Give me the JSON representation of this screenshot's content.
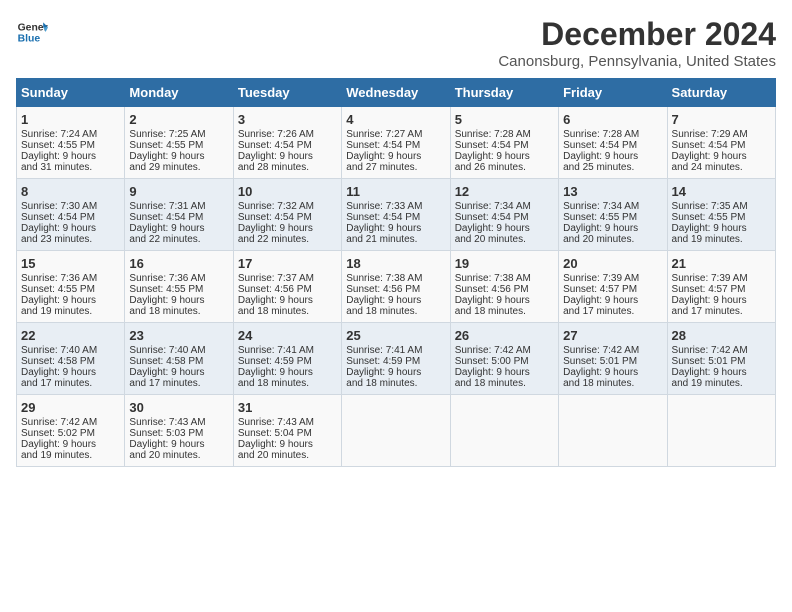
{
  "header": {
    "logo_line1": "General",
    "logo_line2": "Blue",
    "title": "December 2024",
    "subtitle": "Canonsburg, Pennsylvania, United States"
  },
  "days_of_week": [
    "Sunday",
    "Monday",
    "Tuesday",
    "Wednesday",
    "Thursday",
    "Friday",
    "Saturday"
  ],
  "weeks": [
    [
      {
        "day": "1",
        "lines": [
          "Sunrise: 7:24 AM",
          "Sunset: 4:55 PM",
          "Daylight: 9 hours",
          "and 31 minutes."
        ]
      },
      {
        "day": "2",
        "lines": [
          "Sunrise: 7:25 AM",
          "Sunset: 4:55 PM",
          "Daylight: 9 hours",
          "and 29 minutes."
        ]
      },
      {
        "day": "3",
        "lines": [
          "Sunrise: 7:26 AM",
          "Sunset: 4:54 PM",
          "Daylight: 9 hours",
          "and 28 minutes."
        ]
      },
      {
        "day": "4",
        "lines": [
          "Sunrise: 7:27 AM",
          "Sunset: 4:54 PM",
          "Daylight: 9 hours",
          "and 27 minutes."
        ]
      },
      {
        "day": "5",
        "lines": [
          "Sunrise: 7:28 AM",
          "Sunset: 4:54 PM",
          "Daylight: 9 hours",
          "and 26 minutes."
        ]
      },
      {
        "day": "6",
        "lines": [
          "Sunrise: 7:28 AM",
          "Sunset: 4:54 PM",
          "Daylight: 9 hours",
          "and 25 minutes."
        ]
      },
      {
        "day": "7",
        "lines": [
          "Sunrise: 7:29 AM",
          "Sunset: 4:54 PM",
          "Daylight: 9 hours",
          "and 24 minutes."
        ]
      }
    ],
    [
      {
        "day": "8",
        "lines": [
          "Sunrise: 7:30 AM",
          "Sunset: 4:54 PM",
          "Daylight: 9 hours",
          "and 23 minutes."
        ]
      },
      {
        "day": "9",
        "lines": [
          "Sunrise: 7:31 AM",
          "Sunset: 4:54 PM",
          "Daylight: 9 hours",
          "and 22 minutes."
        ]
      },
      {
        "day": "10",
        "lines": [
          "Sunrise: 7:32 AM",
          "Sunset: 4:54 PM",
          "Daylight: 9 hours",
          "and 22 minutes."
        ]
      },
      {
        "day": "11",
        "lines": [
          "Sunrise: 7:33 AM",
          "Sunset: 4:54 PM",
          "Daylight: 9 hours",
          "and 21 minutes."
        ]
      },
      {
        "day": "12",
        "lines": [
          "Sunrise: 7:34 AM",
          "Sunset: 4:54 PM",
          "Daylight: 9 hours",
          "and 20 minutes."
        ]
      },
      {
        "day": "13",
        "lines": [
          "Sunrise: 7:34 AM",
          "Sunset: 4:55 PM",
          "Daylight: 9 hours",
          "and 20 minutes."
        ]
      },
      {
        "day": "14",
        "lines": [
          "Sunrise: 7:35 AM",
          "Sunset: 4:55 PM",
          "Daylight: 9 hours",
          "and 19 minutes."
        ]
      }
    ],
    [
      {
        "day": "15",
        "lines": [
          "Sunrise: 7:36 AM",
          "Sunset: 4:55 PM",
          "Daylight: 9 hours",
          "and 19 minutes."
        ]
      },
      {
        "day": "16",
        "lines": [
          "Sunrise: 7:36 AM",
          "Sunset: 4:55 PM",
          "Daylight: 9 hours",
          "and 18 minutes."
        ]
      },
      {
        "day": "17",
        "lines": [
          "Sunrise: 7:37 AM",
          "Sunset: 4:56 PM",
          "Daylight: 9 hours",
          "and 18 minutes."
        ]
      },
      {
        "day": "18",
        "lines": [
          "Sunrise: 7:38 AM",
          "Sunset: 4:56 PM",
          "Daylight: 9 hours",
          "and 18 minutes."
        ]
      },
      {
        "day": "19",
        "lines": [
          "Sunrise: 7:38 AM",
          "Sunset: 4:56 PM",
          "Daylight: 9 hours",
          "and 18 minutes."
        ]
      },
      {
        "day": "20",
        "lines": [
          "Sunrise: 7:39 AM",
          "Sunset: 4:57 PM",
          "Daylight: 9 hours",
          "and 17 minutes."
        ]
      },
      {
        "day": "21",
        "lines": [
          "Sunrise: 7:39 AM",
          "Sunset: 4:57 PM",
          "Daylight: 9 hours",
          "and 17 minutes."
        ]
      }
    ],
    [
      {
        "day": "22",
        "lines": [
          "Sunrise: 7:40 AM",
          "Sunset: 4:58 PM",
          "Daylight: 9 hours",
          "and 17 minutes."
        ]
      },
      {
        "day": "23",
        "lines": [
          "Sunrise: 7:40 AM",
          "Sunset: 4:58 PM",
          "Daylight: 9 hours",
          "and 17 minutes."
        ]
      },
      {
        "day": "24",
        "lines": [
          "Sunrise: 7:41 AM",
          "Sunset: 4:59 PM",
          "Daylight: 9 hours",
          "and 18 minutes."
        ]
      },
      {
        "day": "25",
        "lines": [
          "Sunrise: 7:41 AM",
          "Sunset: 4:59 PM",
          "Daylight: 9 hours",
          "and 18 minutes."
        ]
      },
      {
        "day": "26",
        "lines": [
          "Sunrise: 7:42 AM",
          "Sunset: 5:00 PM",
          "Daylight: 9 hours",
          "and 18 minutes."
        ]
      },
      {
        "day": "27",
        "lines": [
          "Sunrise: 7:42 AM",
          "Sunset: 5:01 PM",
          "Daylight: 9 hours",
          "and 18 minutes."
        ]
      },
      {
        "day": "28",
        "lines": [
          "Sunrise: 7:42 AM",
          "Sunset: 5:01 PM",
          "Daylight: 9 hours",
          "and 19 minutes."
        ]
      }
    ],
    [
      {
        "day": "29",
        "lines": [
          "Sunrise: 7:42 AM",
          "Sunset: 5:02 PM",
          "Daylight: 9 hours",
          "and 19 minutes."
        ]
      },
      {
        "day": "30",
        "lines": [
          "Sunrise: 7:43 AM",
          "Sunset: 5:03 PM",
          "Daylight: 9 hours",
          "and 20 minutes."
        ]
      },
      {
        "day": "31",
        "lines": [
          "Sunrise: 7:43 AM",
          "Sunset: 5:04 PM",
          "Daylight: 9 hours",
          "and 20 minutes."
        ]
      },
      null,
      null,
      null,
      null
    ]
  ]
}
